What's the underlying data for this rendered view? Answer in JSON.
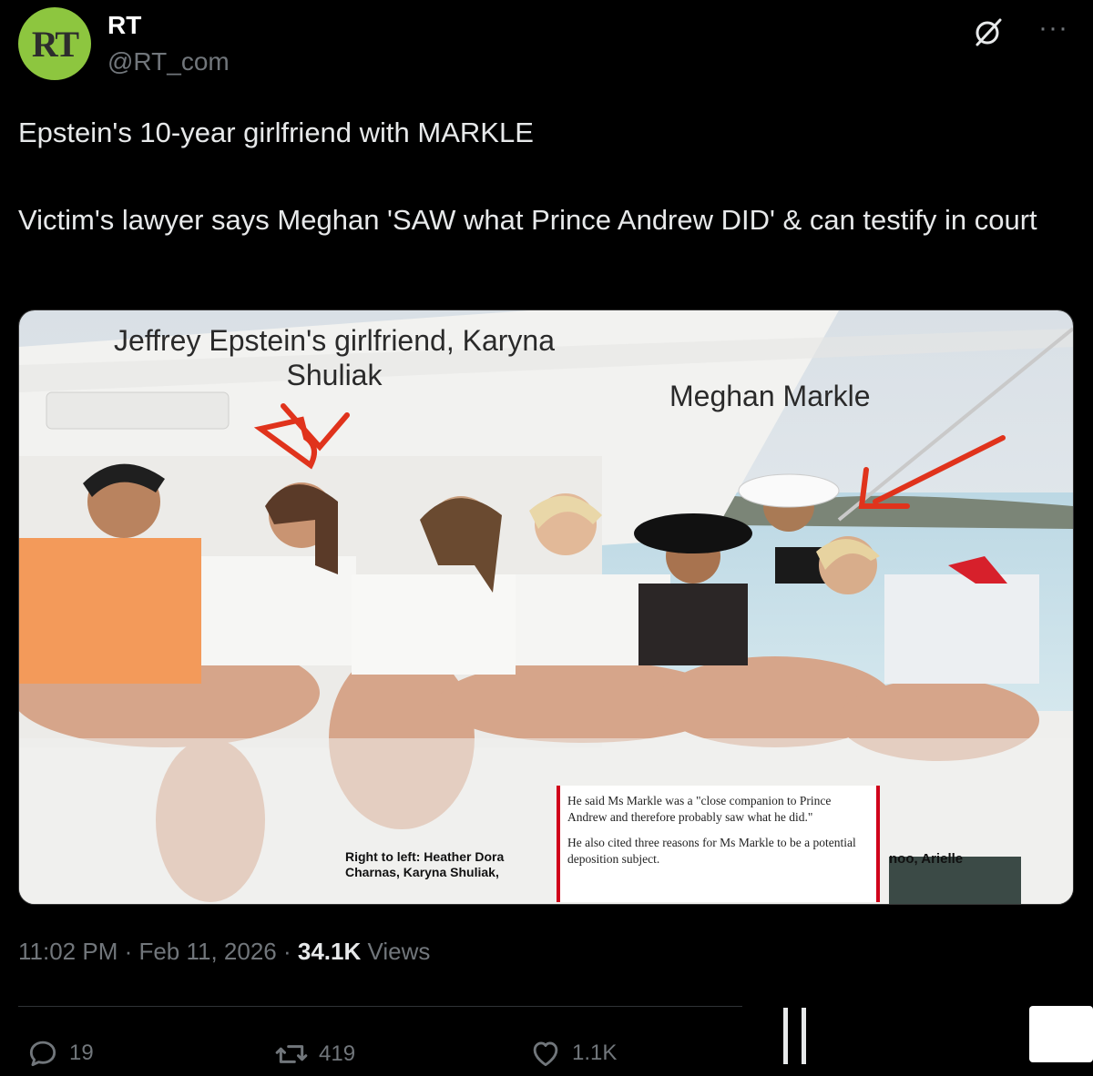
{
  "account": {
    "avatar_text": "RT",
    "avatar_color": "#8dc63f",
    "name": "RT",
    "handle": "@RT_com"
  },
  "icons": [
    "grok-icon",
    "more-icon",
    "reply-icon",
    "repost-icon",
    "like-icon",
    "analytics-icon"
  ],
  "tweet": {
    "text": "Epstein's 10-year girlfriend with MARKLE\n\nVictim's lawyer says Meghan 'SAW what Prince Andrew DID' & can testify in court"
  },
  "media": {
    "label_karyna": "Jeffrey Epstein's girlfriend, Karyna Shuliak",
    "label_meghan": "Meghan Markle",
    "caption_line1": "Right to left: Heather Dora",
    "caption_line2": "Charnas, Karyna Shuliak,",
    "caption_right": "noo, Arielle",
    "clip_p1": "He said Ms Markle was a \"close companion to Prince Andrew and therefore probably saw what he did.\"",
    "clip_p2": "He also cited three reasons for Ms Markle to be a potential deposition subject.",
    "arrow_color": "#e0331c"
  },
  "meta": {
    "time": "11:02 PM",
    "sep": " · ",
    "date": "Feb 11, 2026",
    "views_count": "34.1K",
    "views_label": " Views"
  },
  "actions": {
    "replies": "19",
    "reposts": "419",
    "likes": "1.1K"
  }
}
